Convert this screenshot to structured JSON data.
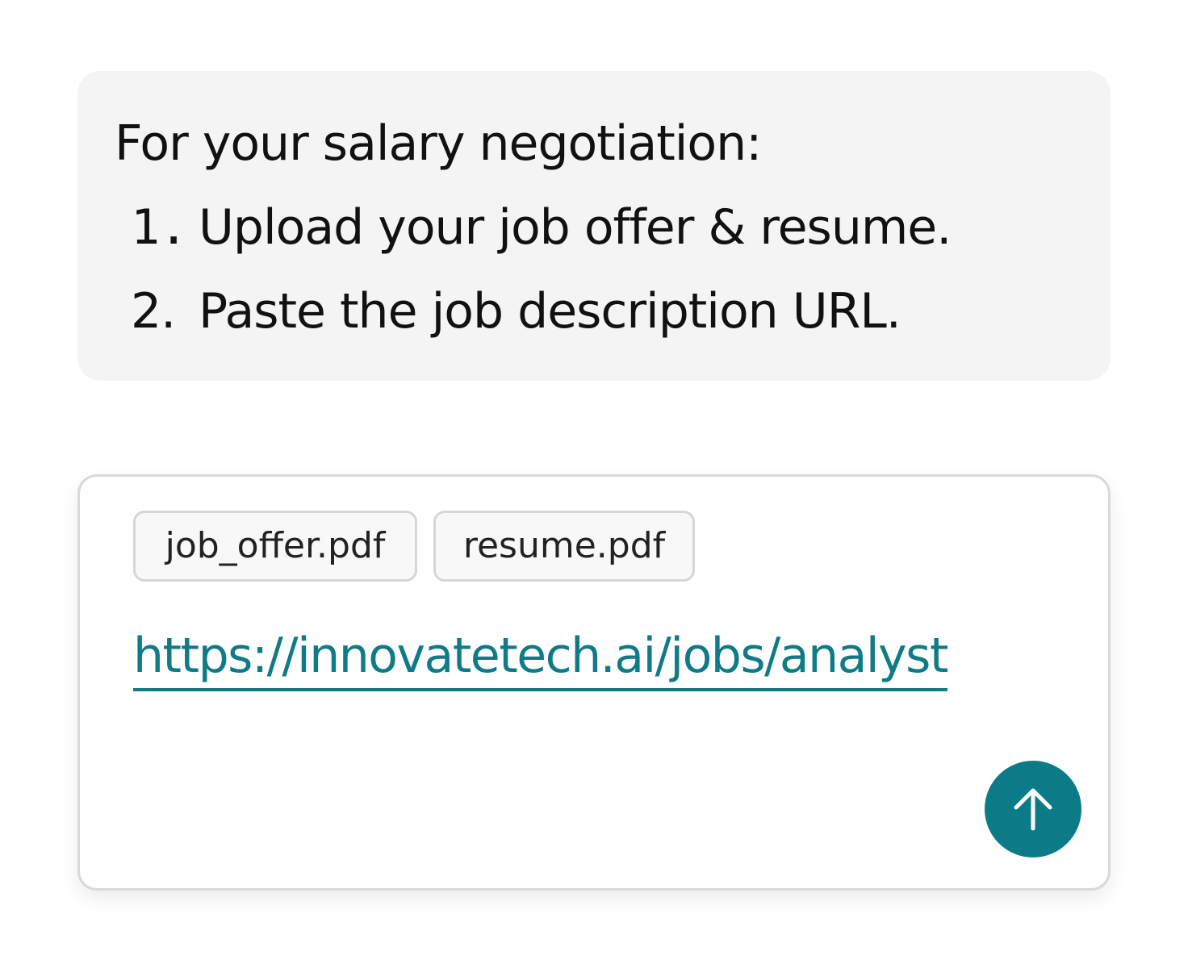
{
  "instructions": {
    "intro": "For your salary negotiation:",
    "steps": [
      {
        "number": "1.",
        "text": "Upload your job offer & resume."
      },
      {
        "number": "2.",
        "text": "Paste the job description URL."
      }
    ]
  },
  "composer": {
    "attachments": [
      {
        "name": "job_offer.pdf"
      },
      {
        "name": "resume.pdf"
      }
    ],
    "url": "https://innovatetech.ai/jobs/analyst",
    "send_icon": "arrow-up-icon"
  },
  "colors": {
    "accent": "#0b7c87",
    "link": "#0f7b86",
    "panel_bg": "#f4f4f4"
  }
}
